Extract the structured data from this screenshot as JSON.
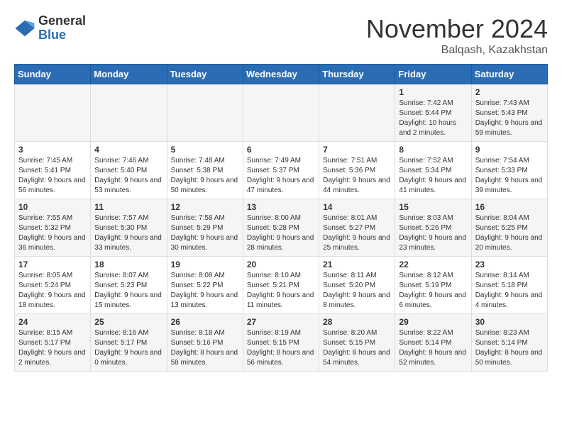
{
  "logo": {
    "general": "General",
    "blue": "Blue"
  },
  "title": "November 2024",
  "subtitle": "Balqash, Kazakhstan",
  "weekdays": [
    "Sunday",
    "Monday",
    "Tuesday",
    "Wednesday",
    "Thursday",
    "Friday",
    "Saturday"
  ],
  "weeks": [
    [
      {
        "day": "",
        "info": ""
      },
      {
        "day": "",
        "info": ""
      },
      {
        "day": "",
        "info": ""
      },
      {
        "day": "",
        "info": ""
      },
      {
        "day": "",
        "info": ""
      },
      {
        "day": "1",
        "info": "Sunrise: 7:42 AM\nSunset: 5:44 PM\nDaylight: 10 hours and 2 minutes."
      },
      {
        "day": "2",
        "info": "Sunrise: 7:43 AM\nSunset: 5:43 PM\nDaylight: 9 hours and 59 minutes."
      }
    ],
    [
      {
        "day": "3",
        "info": "Sunrise: 7:45 AM\nSunset: 5:41 PM\nDaylight: 9 hours and 56 minutes."
      },
      {
        "day": "4",
        "info": "Sunrise: 7:46 AM\nSunset: 5:40 PM\nDaylight: 9 hours and 53 minutes."
      },
      {
        "day": "5",
        "info": "Sunrise: 7:48 AM\nSunset: 5:38 PM\nDaylight: 9 hours and 50 minutes."
      },
      {
        "day": "6",
        "info": "Sunrise: 7:49 AM\nSunset: 5:37 PM\nDaylight: 9 hours and 47 minutes."
      },
      {
        "day": "7",
        "info": "Sunrise: 7:51 AM\nSunset: 5:36 PM\nDaylight: 9 hours and 44 minutes."
      },
      {
        "day": "8",
        "info": "Sunrise: 7:52 AM\nSunset: 5:34 PM\nDaylight: 9 hours and 41 minutes."
      },
      {
        "day": "9",
        "info": "Sunrise: 7:54 AM\nSunset: 5:33 PM\nDaylight: 9 hours and 39 minutes."
      }
    ],
    [
      {
        "day": "10",
        "info": "Sunrise: 7:55 AM\nSunset: 5:32 PM\nDaylight: 9 hours and 36 minutes."
      },
      {
        "day": "11",
        "info": "Sunrise: 7:57 AM\nSunset: 5:30 PM\nDaylight: 9 hours and 33 minutes."
      },
      {
        "day": "12",
        "info": "Sunrise: 7:58 AM\nSunset: 5:29 PM\nDaylight: 9 hours and 30 minutes."
      },
      {
        "day": "13",
        "info": "Sunrise: 8:00 AM\nSunset: 5:28 PM\nDaylight: 9 hours and 28 minutes."
      },
      {
        "day": "14",
        "info": "Sunrise: 8:01 AM\nSunset: 5:27 PM\nDaylight: 9 hours and 25 minutes."
      },
      {
        "day": "15",
        "info": "Sunrise: 8:03 AM\nSunset: 5:26 PM\nDaylight: 9 hours and 23 minutes."
      },
      {
        "day": "16",
        "info": "Sunrise: 8:04 AM\nSunset: 5:25 PM\nDaylight: 9 hours and 20 minutes."
      }
    ],
    [
      {
        "day": "17",
        "info": "Sunrise: 8:05 AM\nSunset: 5:24 PM\nDaylight: 9 hours and 18 minutes."
      },
      {
        "day": "18",
        "info": "Sunrise: 8:07 AM\nSunset: 5:23 PM\nDaylight: 9 hours and 15 minutes."
      },
      {
        "day": "19",
        "info": "Sunrise: 8:08 AM\nSunset: 5:22 PM\nDaylight: 9 hours and 13 minutes."
      },
      {
        "day": "20",
        "info": "Sunrise: 8:10 AM\nSunset: 5:21 PM\nDaylight: 9 hours and 11 minutes."
      },
      {
        "day": "21",
        "info": "Sunrise: 8:11 AM\nSunset: 5:20 PM\nDaylight: 9 hours and 8 minutes."
      },
      {
        "day": "22",
        "info": "Sunrise: 8:12 AM\nSunset: 5:19 PM\nDaylight: 9 hours and 6 minutes."
      },
      {
        "day": "23",
        "info": "Sunrise: 8:14 AM\nSunset: 5:18 PM\nDaylight: 9 hours and 4 minutes."
      }
    ],
    [
      {
        "day": "24",
        "info": "Sunrise: 8:15 AM\nSunset: 5:17 PM\nDaylight: 9 hours and 2 minutes."
      },
      {
        "day": "25",
        "info": "Sunrise: 8:16 AM\nSunset: 5:17 PM\nDaylight: 9 hours and 0 minutes."
      },
      {
        "day": "26",
        "info": "Sunrise: 8:18 AM\nSunset: 5:16 PM\nDaylight: 8 hours and 58 minutes."
      },
      {
        "day": "27",
        "info": "Sunrise: 8:19 AM\nSunset: 5:15 PM\nDaylight: 8 hours and 56 minutes."
      },
      {
        "day": "28",
        "info": "Sunrise: 8:20 AM\nSunset: 5:15 PM\nDaylight: 8 hours and 54 minutes."
      },
      {
        "day": "29",
        "info": "Sunrise: 8:22 AM\nSunset: 5:14 PM\nDaylight: 8 hours and 52 minutes."
      },
      {
        "day": "30",
        "info": "Sunrise: 8:23 AM\nSunset: 5:14 PM\nDaylight: 8 hours and 50 minutes."
      }
    ]
  ]
}
